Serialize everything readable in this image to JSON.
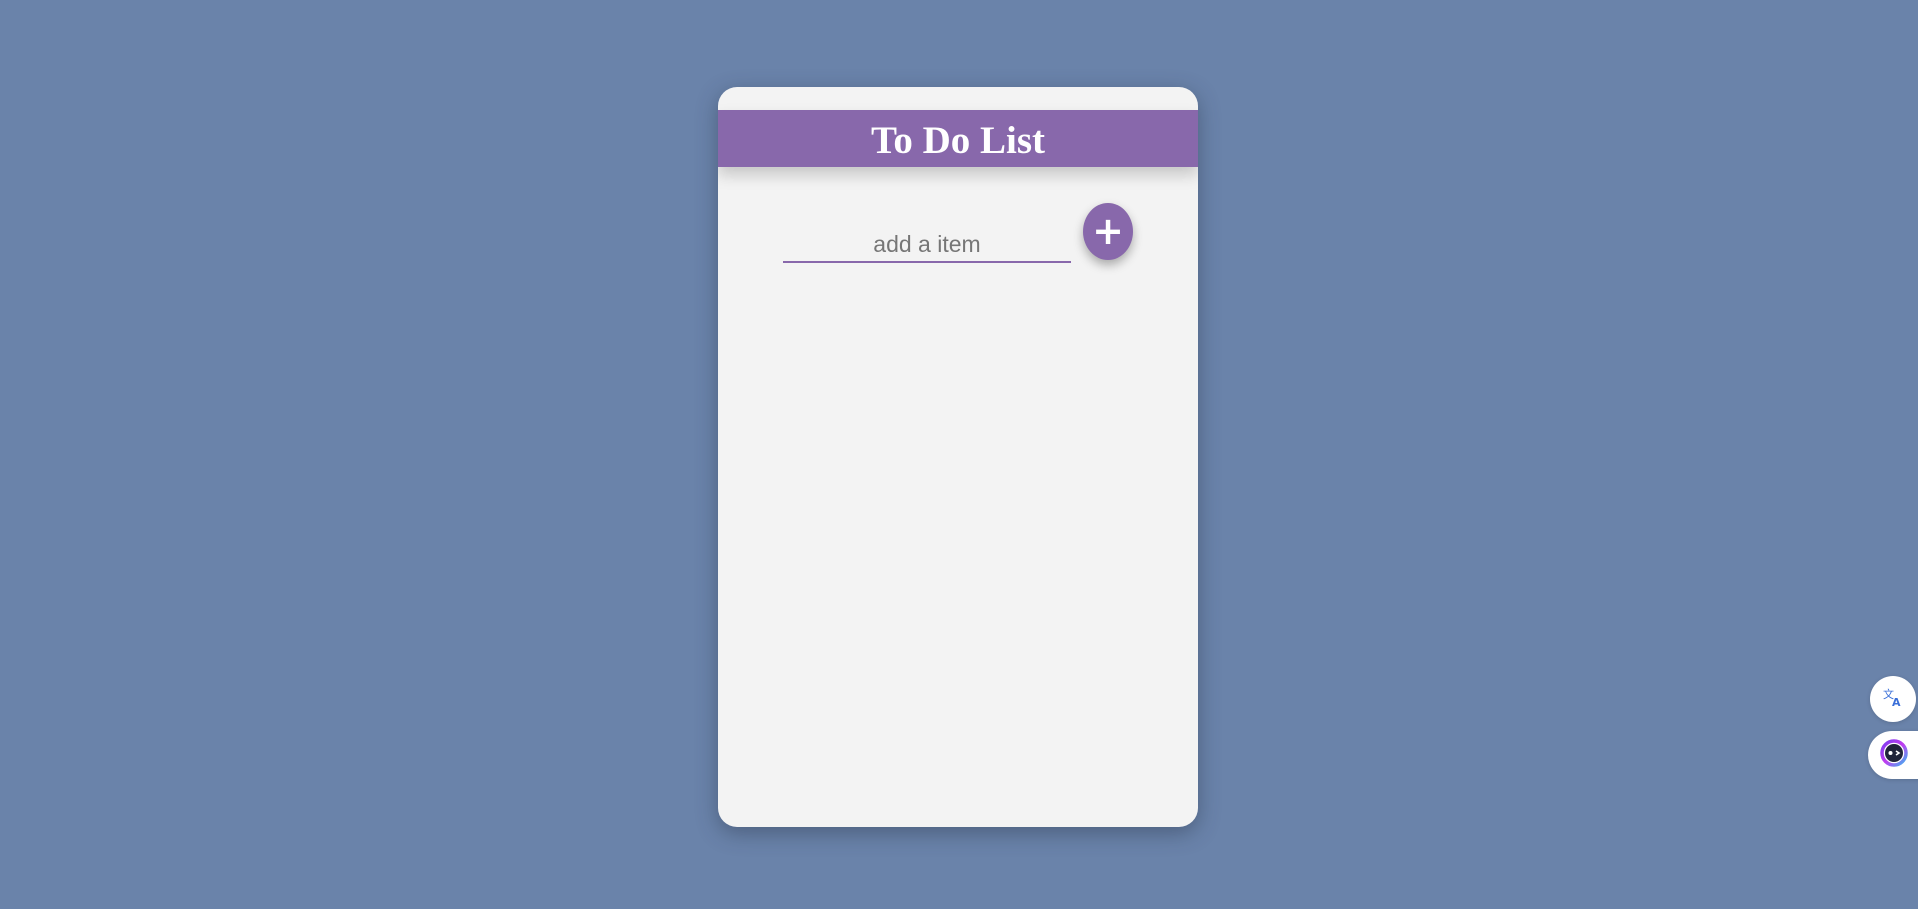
{
  "app": {
    "title": "To Do List"
  },
  "add_form": {
    "placeholder": "add a item",
    "value": "",
    "add_button_label": "+"
  },
  "items": [],
  "side_tools": [
    {
      "icon": "translate-icon"
    },
    {
      "icon": "assistant-icon"
    }
  ],
  "colors": {
    "background": "#6a83aa",
    "card": "#f3f3f3",
    "accent": "#8868ab",
    "title_text": "#ffffff"
  }
}
